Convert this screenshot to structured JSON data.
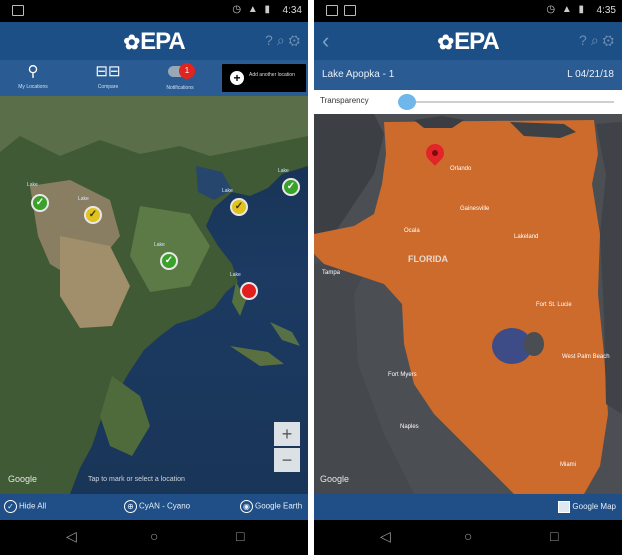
{
  "left": {
    "status": {
      "time": "4:34"
    },
    "app_logo": "EPA",
    "tabs": [
      {
        "icon": "pin-icon",
        "label": "My Locations"
      },
      {
        "icon": "compare-icon",
        "label": "Compare"
      },
      {
        "icon": "toggle-icon",
        "label": "Notifications",
        "badge": "1"
      }
    ],
    "add_button": {
      "label": "Add another location"
    },
    "map": {
      "markers": [
        {
          "color": "green",
          "label": "Lake"
        },
        {
          "color": "yellow",
          "label": "Lake"
        },
        {
          "color": "green",
          "label": "Lake"
        },
        {
          "color": "yellow",
          "label": "Lake"
        },
        {
          "color": "green",
          "label": "Lake"
        },
        {
          "color": "red",
          "label": "Lake"
        }
      ],
      "zoom_in": "+",
      "zoom_out": "−",
      "google": "Google",
      "hint": "Tap to mark or select a location"
    },
    "bottom": [
      {
        "icon": "check-icon",
        "label": "Hide All"
      },
      {
        "icon": "globe-icon",
        "label": "CyAN - Cyano"
      },
      {
        "icon": "earth-icon",
        "label": "Google Earth"
      }
    ]
  },
  "right": {
    "status": {
      "time": "4:35"
    },
    "app_logo": "EPA",
    "location_name": "Lake Apopka - 1",
    "date": "L 04/21/18",
    "transparency_label": "Transparency",
    "transparency_value": 0.0,
    "map": {
      "region": "FLORIDA",
      "cities": [
        "Orlando",
        "Gainesville",
        "Ocala",
        "Tampa",
        "Fort St. Lucie",
        "West Palm Beach",
        "Fort Myers",
        "Naples",
        "Miami",
        "Lakeland"
      ],
      "google": "Google"
    },
    "bottom_button": "Google Map"
  },
  "nav": {
    "back": "◁",
    "home": "○",
    "recent": "□"
  }
}
